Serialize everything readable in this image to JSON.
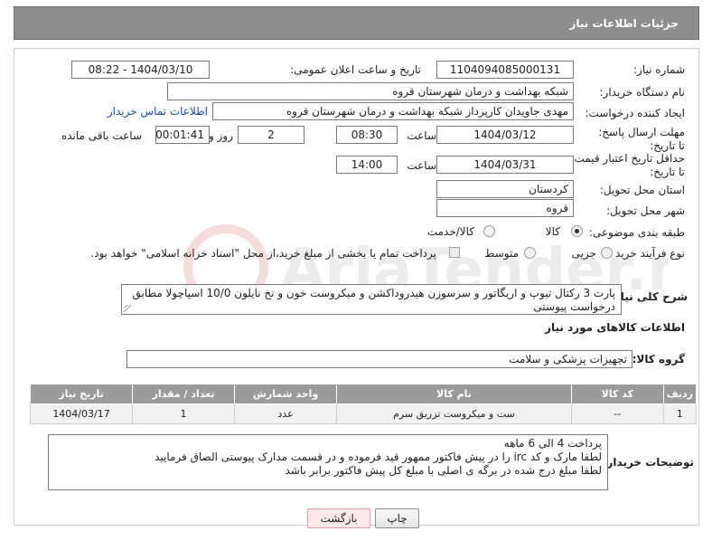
{
  "header": {
    "title": "جزئیات اطلاعات نیاز"
  },
  "need_number": {
    "label": "شماره نیاز:",
    "value": "1104094085000131"
  },
  "announce_datetime": {
    "label": "تاریخ و ساعت اعلان عمومی:",
    "value": "1404/03/10 - 08:22"
  },
  "buyer_org": {
    "label": "نام دستگاه خریدار:",
    "value": "شبکه بهداشت و درمان شهرستان قروه"
  },
  "creator": {
    "label": "ایجاد کننده درخواست:",
    "value": "مهدی جاویدان کارپرداز شبکه بهداشت و درمان شهرستان قروه",
    "contact_link": "اطلاعات تماس خریدار"
  },
  "reply_deadline": {
    "label": "مهلت ارسال پاسخ: تا تاریخ:",
    "date": "1404/03/12",
    "time_label": "ساعت",
    "time": "08:30",
    "days": "2",
    "days_label": "روز و",
    "remaining": "00:01:41",
    "remaining_label": "ساعت باقی مانده"
  },
  "price_validity": {
    "label": "حداقل تاریخ اعتبار قیمت: تا تاریخ:",
    "date": "1404/03/31",
    "time_label": "ساعت",
    "time": "14:00"
  },
  "delivery_province": {
    "label": "استان محل تحویل:",
    "value": "کردستان"
  },
  "delivery_city": {
    "label": "شهر محل تحویل:",
    "value": "قروه"
  },
  "category": {
    "label": "طبقه بندی موضوعی:",
    "options": [
      "کالا",
      "کالا/خدمت"
    ],
    "selected": "کالا"
  },
  "purchase_type": {
    "label": "نوع فرآیند خرید :",
    "options": [
      "جزیی",
      "متوسط"
    ],
    "selected": "",
    "payment_note": "پرداخت تمام یا بخشی از مبلغ خرید،از محل \"اسناد خزانه اسلامی\" خواهد بود."
  },
  "description": {
    "label": "شرح کلی نیاز:",
    "text": "پارت 3 رکتال تیوپ و اریگاتور و سرسوزن هیدروداکشن و میکروست خون و نخ نایلون 10/0 اسپاچولا مطابق درخواست پیوستی"
  },
  "goods_info": {
    "title": "اطلاعات کالاهای مورد نیاز"
  },
  "goods_group": {
    "label": "گروه کالا:",
    "value": "تجهیزات پزشکی و سلامت"
  },
  "table": {
    "headers": [
      "ردیف",
      "کد کالا",
      "نام کالا",
      "واحد شمارش",
      "تعداد / مقدار",
      "تاریخ نیاز"
    ],
    "rows": [
      {
        "row": "1",
        "code": "--",
        "name": "ست و میکروست تزریق سرم",
        "unit": "عدد",
        "qty": "1",
        "date": "1404/03/17"
      }
    ]
  },
  "buyer_notes": {
    "label": "توضیحات خریدار:",
    "lines": [
      "پرداخت 4 الی 6 ماهه",
      "لطفا مارک و کد irc  را در پیش فاکتور ممهور قید فرموده و در قسمت مدارک پیوستی الصاق فرمایید",
      "لطفا مبلغ درج شده در برگه ی اصلی با مبلغ کل پیش فاکتور برابر باشد"
    ]
  },
  "buttons": {
    "print": "چاپ",
    "back": "بازگشت"
  },
  "watermark": {
    "text": "AriaTender.neT"
  },
  "colors": {
    "header_bg": "#8e8e8e",
    "table_header_bg": "#9b9b9b",
    "link": "#1a4e9c",
    "back_button_bg": "#fde9ea"
  }
}
